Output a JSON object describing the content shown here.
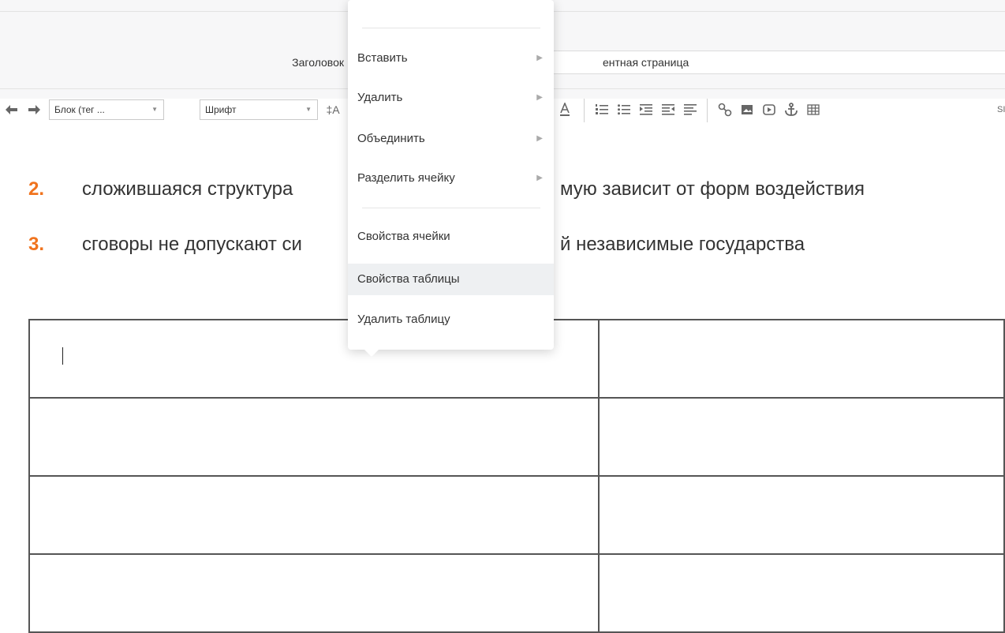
{
  "header": {
    "title_label": "Заголовок",
    "title_value": "ентная страница"
  },
  "toolbar": {
    "block_combo": "Блок (тег ...",
    "font_combo": "Шрифт",
    "fontsize_glyph": "‡A",
    "sup_label": "SI"
  },
  "content": {
    "items": [
      {
        "num": "2.",
        "text": "сложившаяся структура",
        "text_after": "мую зависит от форм воздействия"
      },
      {
        "num": "3.",
        "text": "сговоры не допускают си",
        "text_after": "й независимые государства"
      }
    ]
  },
  "context_menu": {
    "items": [
      {
        "label": "Вставить",
        "has_sub": true
      },
      {
        "label": "Удалить",
        "has_sub": true
      },
      {
        "label": "Объединить",
        "has_sub": true
      },
      {
        "label": "Разделить ячейку",
        "has_sub": true
      },
      {
        "label": "Свойства ячейки",
        "has_sub": false
      },
      {
        "label": "Свойства таблицы",
        "has_sub": false
      },
      {
        "label": "Удалить таблицу",
        "has_sub": false
      }
    ],
    "highlighted": "Свойства таблицы"
  },
  "colors": {
    "list_number": "#f0731e",
    "menu_highlight": "#eef0f2"
  }
}
